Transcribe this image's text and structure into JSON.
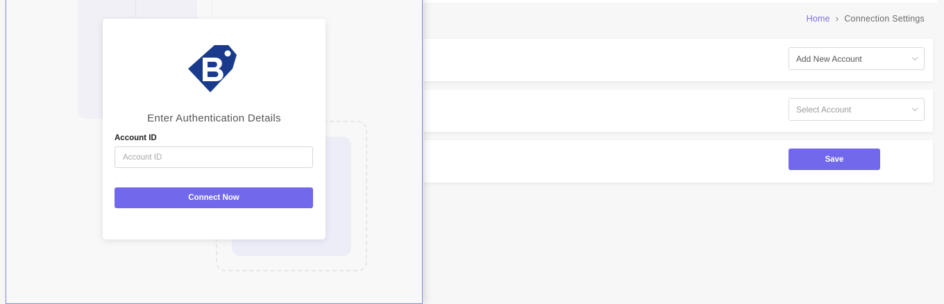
{
  "breadcrumb": {
    "home": "Home",
    "separator": "›",
    "current": "Connection Settings"
  },
  "settings": {
    "account_select": {
      "value": "Add New Account"
    },
    "select_account": {
      "placeholder": "Select Account"
    },
    "save_label": "Save"
  },
  "auth_modal": {
    "logo_icon": "b-tag-logo-icon",
    "title": "Enter Authentication Details",
    "account_id_label": "Account ID",
    "account_id_placeholder": "Account ID",
    "account_id_value": "",
    "connect_label": "Connect Now"
  },
  "colors": {
    "accent": "#7268ec",
    "logo_blue": "#1a3a8c",
    "breadcrumb_link": "#7b70d8"
  }
}
